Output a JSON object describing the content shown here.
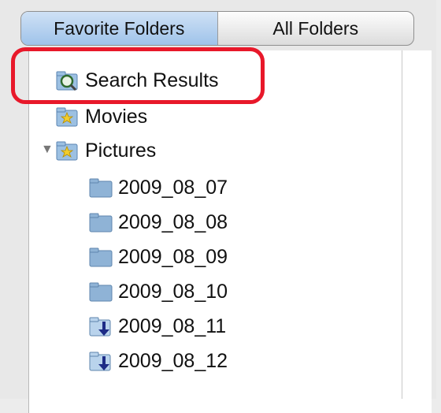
{
  "tabs": [
    {
      "label": "Favorite Folders",
      "active": true
    },
    {
      "label": "All Folders",
      "active": false
    }
  ],
  "tree": {
    "search_results": "Search Results",
    "movies": "Movies",
    "pictures": "Pictures",
    "folders": [
      "2009_08_07",
      "2009_08_08",
      "2009_08_09",
      "2009_08_10",
      "2009_08_11",
      "2009_08_12"
    ]
  },
  "colors": {
    "highlight": "#e8182a",
    "active_tab": "#9fc3ea",
    "folder_blue": "#8fb3d6"
  }
}
